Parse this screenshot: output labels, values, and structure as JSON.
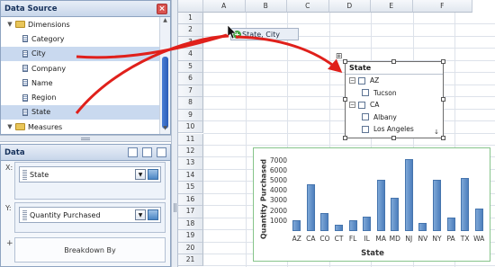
{
  "data_source": {
    "title": "Data Source",
    "tree": [
      {
        "label": "Dimensions",
        "type": "folder",
        "level": 0
      },
      {
        "label": "Category",
        "type": "field",
        "level": 1
      },
      {
        "label": "City",
        "type": "field",
        "level": 1,
        "selected": true
      },
      {
        "label": "Company",
        "type": "field",
        "level": 1
      },
      {
        "label": "Name",
        "type": "field",
        "level": 1
      },
      {
        "label": "Region",
        "type": "field",
        "level": 1
      },
      {
        "label": "State",
        "type": "field",
        "level": 1,
        "selected": true
      },
      {
        "label": "Measures",
        "type": "folder",
        "level": 0
      }
    ]
  },
  "data_panel": {
    "title": "Data",
    "x_label": "X:",
    "x_field": "State",
    "y_label": "Y:",
    "y_field": "Quantity Purchased",
    "plus_label": "+",
    "breakdown_label": "Breakdown By"
  },
  "sheet": {
    "columns": [
      "A",
      "B",
      "C",
      "D",
      "E",
      "F"
    ],
    "rows": [
      "1",
      "2",
      "3",
      "4",
      "5",
      "6",
      "7",
      "8",
      "9",
      "10",
      "11",
      "12",
      "13",
      "14",
      "15",
      "16",
      "17",
      "18",
      "19",
      "20",
      "21"
    ]
  },
  "drag_tag": {
    "label": "State, City"
  },
  "state_filter": {
    "title": "State",
    "items": [
      {
        "label": "AZ",
        "kind": "group"
      },
      {
        "label": "Tucson",
        "kind": "item"
      },
      {
        "label": "CA",
        "kind": "group"
      },
      {
        "label": "Albany",
        "kind": "item"
      },
      {
        "label": "Los Angeles",
        "kind": "item"
      }
    ]
  },
  "chart_data": {
    "type": "bar",
    "title": "",
    "xlabel": "State",
    "ylabel": "Quantity Purchased",
    "categories": [
      "AZ",
      "CA",
      "CO",
      "CT",
      "FL",
      "IL",
      "MA",
      "MD",
      "NJ",
      "NV",
      "NY",
      "PA",
      "TX",
      "WA"
    ],
    "values": [
      1100,
      4600,
      1800,
      600,
      1100,
      1400,
      5100,
      3300,
      7100,
      800,
      5100,
      1300,
      5300,
      2200
    ],
    "ylim": [
      0,
      7500
    ],
    "yticks": [
      1000,
      2000,
      3000,
      4000,
      5000,
      6000,
      7000
    ],
    "grid": false,
    "bar_color": "#5b8cc6"
  },
  "colors": {
    "accent": "#2a5cb6",
    "arrow": "#e0201b",
    "selection": "#c9d9ef",
    "chart_border": "#86c48a"
  }
}
